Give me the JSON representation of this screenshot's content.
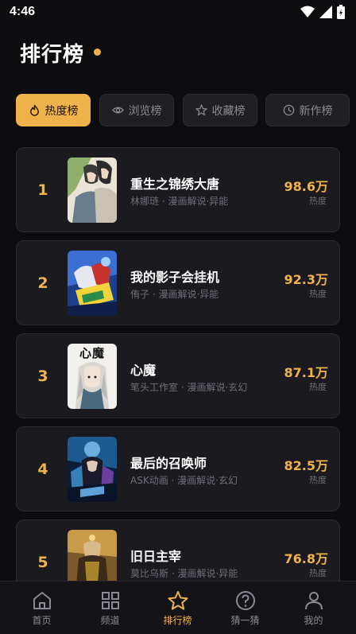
{
  "status": {
    "time": "4:46"
  },
  "header": {
    "title": "排行榜"
  },
  "tabs": [
    {
      "label": "热度榜",
      "icon": "flame-icon",
      "active": true
    },
    {
      "label": "浏览榜",
      "icon": "eye-icon",
      "active": false
    },
    {
      "label": "收藏榜",
      "icon": "star-icon",
      "active": false
    },
    {
      "label": "新作榜",
      "icon": "clock-icon",
      "active": false
    }
  ],
  "ranking": [
    {
      "rank": "1",
      "title": "重生之锦绣大唐",
      "meta": "林娜琏 · 漫画解说·异能",
      "heat": "98.6万",
      "heat_label": "热度"
    },
    {
      "rank": "2",
      "title": "我的影子会挂机",
      "meta": "侑子 · 漫画解说·异能",
      "heat": "92.3万",
      "heat_label": "热度"
    },
    {
      "rank": "3",
      "title": "心魔",
      "meta": "笔头工作室 · 漫画解说·玄幻",
      "heat": "87.1万",
      "heat_label": "热度",
      "cover_text": "心魔"
    },
    {
      "rank": "4",
      "title": "最后的召唤师",
      "meta": "ASK动画 · 漫画解说·玄幻",
      "heat": "82.5万",
      "heat_label": "热度"
    },
    {
      "rank": "5",
      "title": "旧日主宰",
      "meta": "莫比乌斯 · 漫画解说·异能",
      "heat": "76.8万",
      "heat_label": "热度"
    }
  ],
  "bottom_nav": [
    {
      "label": "首页",
      "icon": "home-icon",
      "active": false
    },
    {
      "label": "频道",
      "icon": "grid-icon",
      "active": false
    },
    {
      "label": "排行榜",
      "icon": "star-icon",
      "active": true
    },
    {
      "label": "猜一猜",
      "icon": "question-icon",
      "active": false
    },
    {
      "label": "我的",
      "icon": "user-icon",
      "active": false
    }
  ],
  "colors": {
    "accent": "#f0b24a",
    "background": "#0d0d10",
    "card": "#1a1a1f"
  }
}
